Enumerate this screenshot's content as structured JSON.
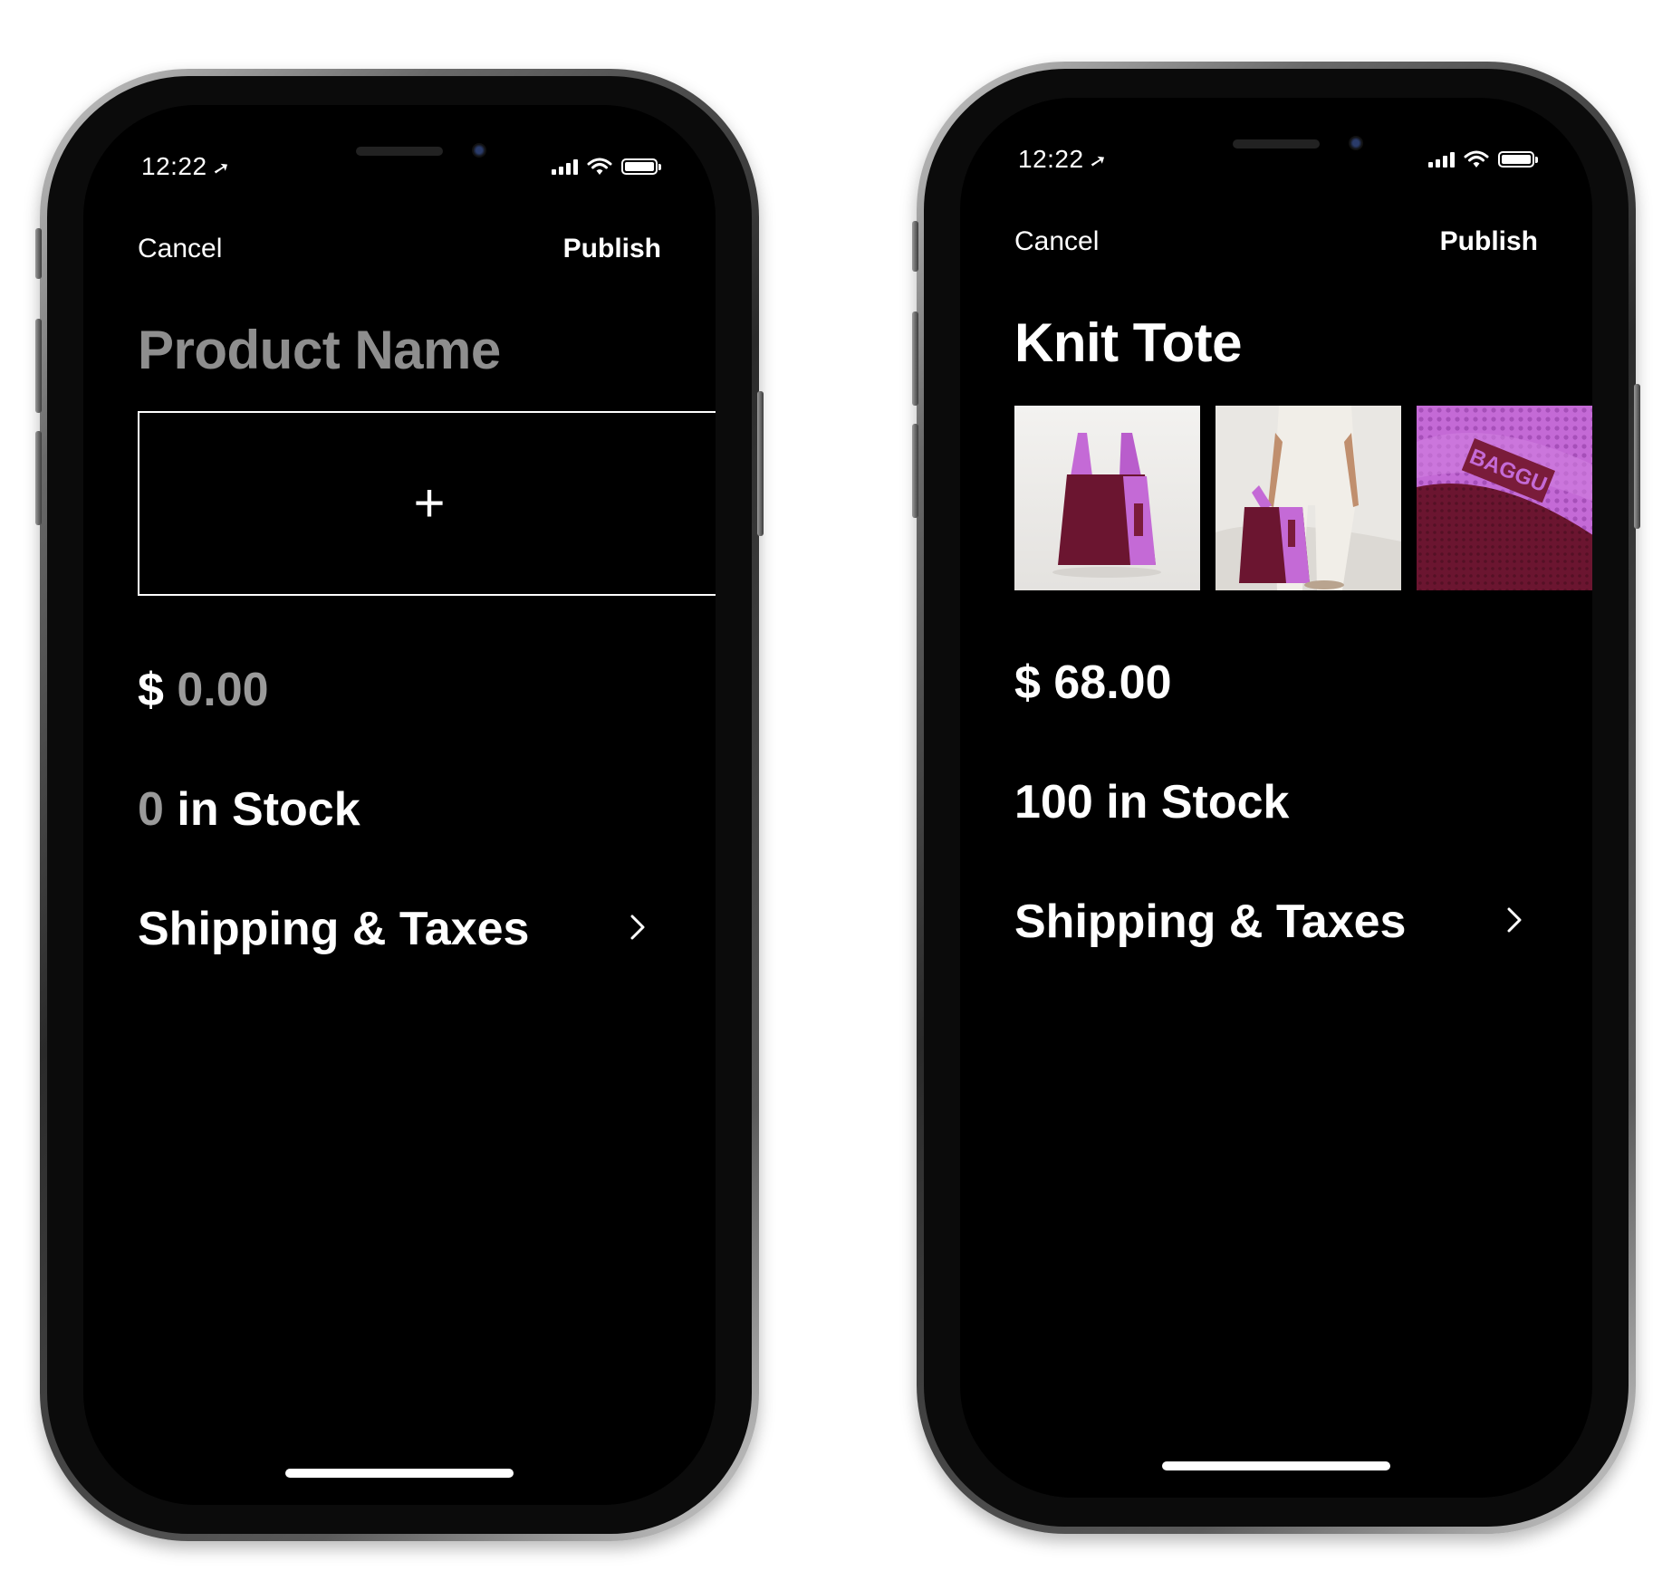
{
  "status_bar": {
    "time": "12:22"
  },
  "left_screen": {
    "cancel_label": "Cancel",
    "publish_label": "Publish",
    "title_placeholder": "Product Name",
    "add_photo_symbol": "+",
    "price_currency": "$",
    "price_value": "0.00",
    "stock_count": "0",
    "stock_suffix": "in Stock",
    "shipping_label": "Shipping & Taxes"
  },
  "right_screen": {
    "cancel_label": "Cancel",
    "publish_label": "Publish",
    "title": "Knit Tote",
    "photos": [
      "tote-front-photo",
      "tote-model-photo",
      "tote-closeup-photo"
    ],
    "photo_brand_text": "BAGGU",
    "price_currency": "$",
    "price_value": "68.00",
    "stock_count": "100",
    "stock_suffix": "in Stock",
    "shipping_label": "Shipping & Taxes"
  },
  "icons": [
    "location-arrow-icon",
    "signal-icon",
    "wifi-icon",
    "battery-icon",
    "plus-icon",
    "chevron-right-icon"
  ],
  "colors": {
    "background": "#000000",
    "text": "#ffffff",
    "placeholder": "#8e8e8e",
    "tote_purple": "#c46ad6",
    "tote_maroon": "#6b1530"
  }
}
